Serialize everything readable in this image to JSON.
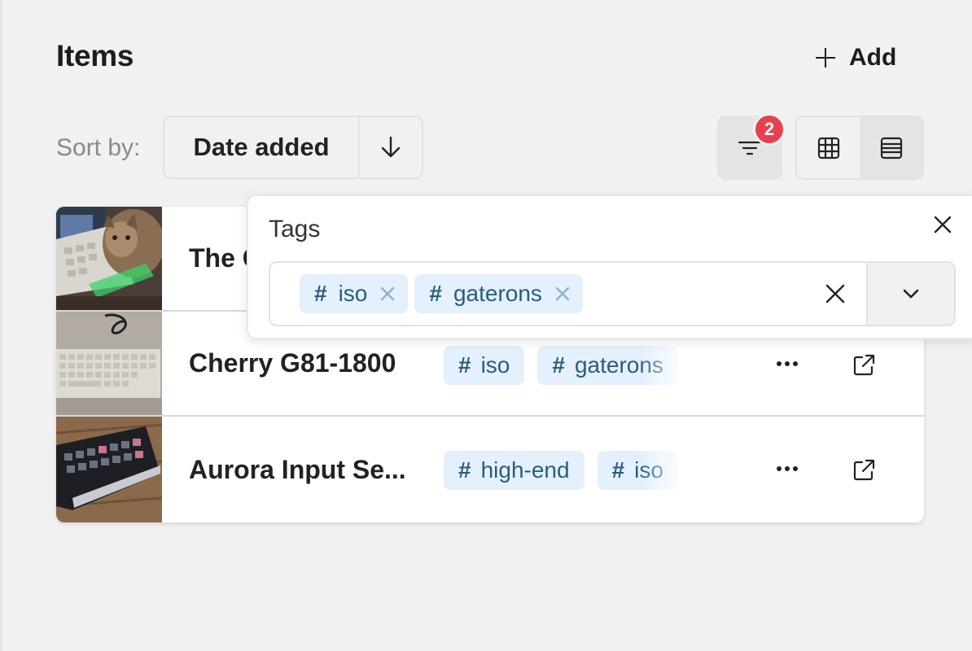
{
  "header": {
    "title": "Items",
    "add_label": "Add"
  },
  "toolbar": {
    "sort_label": "Sort by:",
    "sort_field": "Date added",
    "sort_direction_icon": "arrow-down-icon",
    "filter_count": "2",
    "view_modes": [
      "grid",
      "list"
    ],
    "active_view": "list"
  },
  "items": [
    {
      "name": "The C",
      "thumbnail": "cat-on-keyboard photo",
      "tags": []
    },
    {
      "name": "Cherry G81-1800",
      "thumbnail": "beige keyboard photo",
      "tags": [
        "iso",
        "gaterons"
      ]
    },
    {
      "name": "Aurora Input Se...",
      "thumbnail": "dark keyboard photo",
      "tags": [
        "high-end",
        "iso"
      ]
    }
  ],
  "tag_filter": {
    "title": "Tags",
    "selected": [
      "iso",
      "gaterons"
    ]
  },
  "colors": {
    "tag_bg": "#e4f0fc",
    "tag_text": "#2a5d7d",
    "badge": "#e5404f"
  }
}
